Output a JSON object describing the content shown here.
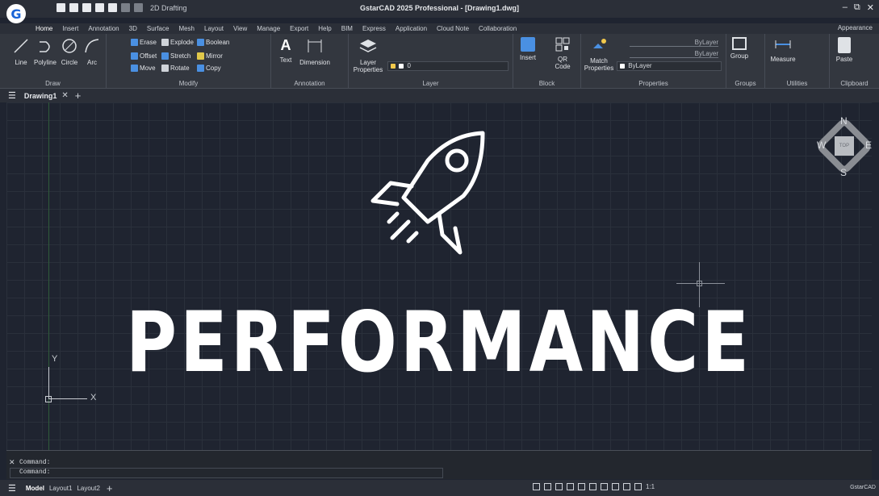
{
  "app": {
    "window_title": "GstarCAD 2025 Professional - [Drawing1.dwg]",
    "workspace": "2D Drafting",
    "logo_letter": "G"
  },
  "menu_tabs": [
    "Home",
    "Insert",
    "Annotation",
    "3D",
    "Surface",
    "Mesh",
    "Layout",
    "View",
    "Manage",
    "Export",
    "Help",
    "BIM",
    "Express",
    "Application",
    "Cloud Note",
    "Collaboration"
  ],
  "appearance_label": "Appearance",
  "ribbon": {
    "draw": {
      "title": "Draw",
      "tools": [
        "Line",
        "Polyline",
        "Circle",
        "Arc"
      ]
    },
    "modify": {
      "title": "Modify",
      "items": [
        "Erase",
        "Explode",
        "Boolean",
        "Offset",
        "Stretch",
        "Mirror",
        "Move",
        "Rotate",
        "Copy"
      ]
    },
    "annotation": {
      "title": "Annotation",
      "tools": [
        "Text",
        "Dimension"
      ]
    },
    "layer": {
      "title": "Layer",
      "tool": "Layer Properties",
      "current_layer": "0"
    },
    "block": {
      "title": "Block",
      "tools": [
        "Insert",
        "QR Code"
      ]
    },
    "properties": {
      "title": "Properties",
      "tool": "Match Properties",
      "color": "ByLayer",
      "linetype": "ByLayer",
      "lineweight": "ByLayer"
    },
    "groups": {
      "title": "Groups",
      "tool": "Group"
    },
    "utilities": {
      "title": "Utilities",
      "tool": "Measure"
    },
    "clipboard": {
      "title": "Clipboard",
      "tool": "Paste"
    }
  },
  "document_tab": "Drawing1",
  "canvas": {
    "headline": "PERFORMANCE",
    "axis_y": "Y",
    "axis_x": "X",
    "viewcube": {
      "top": "TOP",
      "n": "N",
      "s": "S",
      "e": "E",
      "w": "W"
    }
  },
  "command": {
    "line1": "Command:",
    "line2": "Command:"
  },
  "statusbar": {
    "tabs": [
      "Model",
      "Layout1",
      "Layout2"
    ],
    "scale": "1:1",
    "brand": "GstarCAD"
  },
  "colors": {
    "background": "#1f2430",
    "ribbon": "#33373f",
    "accent": "#1a64d6",
    "text": "#ffffff"
  }
}
